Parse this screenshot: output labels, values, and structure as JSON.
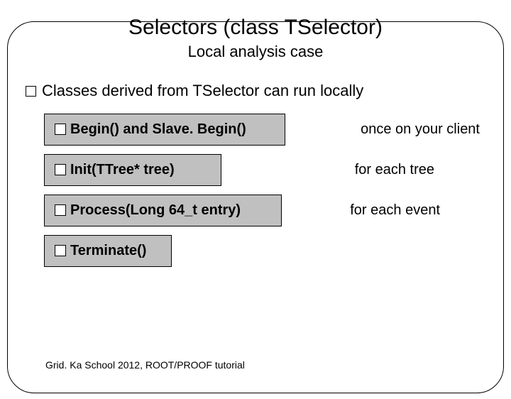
{
  "title": "Selectors (class TSelector)",
  "subtitle": "Local analysis case",
  "bullet_main": "Classes derived from TSelector can run locally",
  "methods": [
    {
      "label": "Begin() and Slave. Begin()",
      "annot": "once on your client"
    },
    {
      "label": "Init(TTree* tree)",
      "annot": "for each tree"
    },
    {
      "label": "Process(Long 64_t entry)",
      "annot": "for each event"
    },
    {
      "label": "Terminate()",
      "annot": ""
    }
  ],
  "footer": "Grid. Ka School 2012, ROOT/PROOF tutorial"
}
